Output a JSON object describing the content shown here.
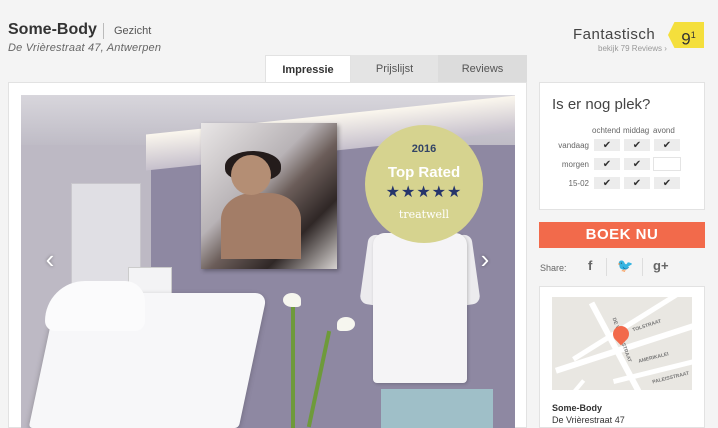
{
  "header": {
    "salon_name": "Some-Body",
    "category": "Gezicht",
    "address": "De Vrièrestraat 47, Antwerpen"
  },
  "rating": {
    "word": "Fantastisch",
    "reviews_link": "bekijk 79 Reviews ›",
    "score": "9",
    "score_sup": "1"
  },
  "tabs": [
    {
      "label": "Impressie",
      "active": true
    },
    {
      "label": "Prijslijst",
      "active": false
    },
    {
      "label": "Reviews",
      "active": false
    }
  ],
  "gallery": {
    "badge": {
      "year": "2016",
      "title": "Top Rated",
      "stars": "★★★★★",
      "brand": "treatwell"
    },
    "prev_icon": "chevron-left-icon",
    "next_icon": "chevron-right-icon"
  },
  "availability": {
    "title": "Is er nog plek?",
    "columns": [
      "ochtend",
      "middag",
      "avond"
    ],
    "rows": [
      {
        "label": "vandaag",
        "cells": [
          "✔",
          "✔",
          "✔"
        ]
      },
      {
        "label": "morgen",
        "cells": [
          "✔",
          "✔",
          ""
        ]
      },
      {
        "label": "15-02",
        "cells": [
          "✔",
          "✔",
          "✔"
        ]
      }
    ]
  },
  "book": {
    "label": "BOEK NU"
  },
  "share": {
    "label": "Share:",
    "facebook": "f",
    "twitter": "🐦",
    "googleplus": "g+"
  },
  "map": {
    "labels": [
      "TOLSTRAAT",
      "AMERIKALEI",
      "DE VRIÈRESTRAAT",
      "PALEISSTRAAT"
    ],
    "name": "Some-Body",
    "address": "De Vrièrestraat 47"
  },
  "colors": {
    "accent": "#f26a4b",
    "rating_badge": "#f4df3c",
    "award_badge": "#d6d38f"
  }
}
